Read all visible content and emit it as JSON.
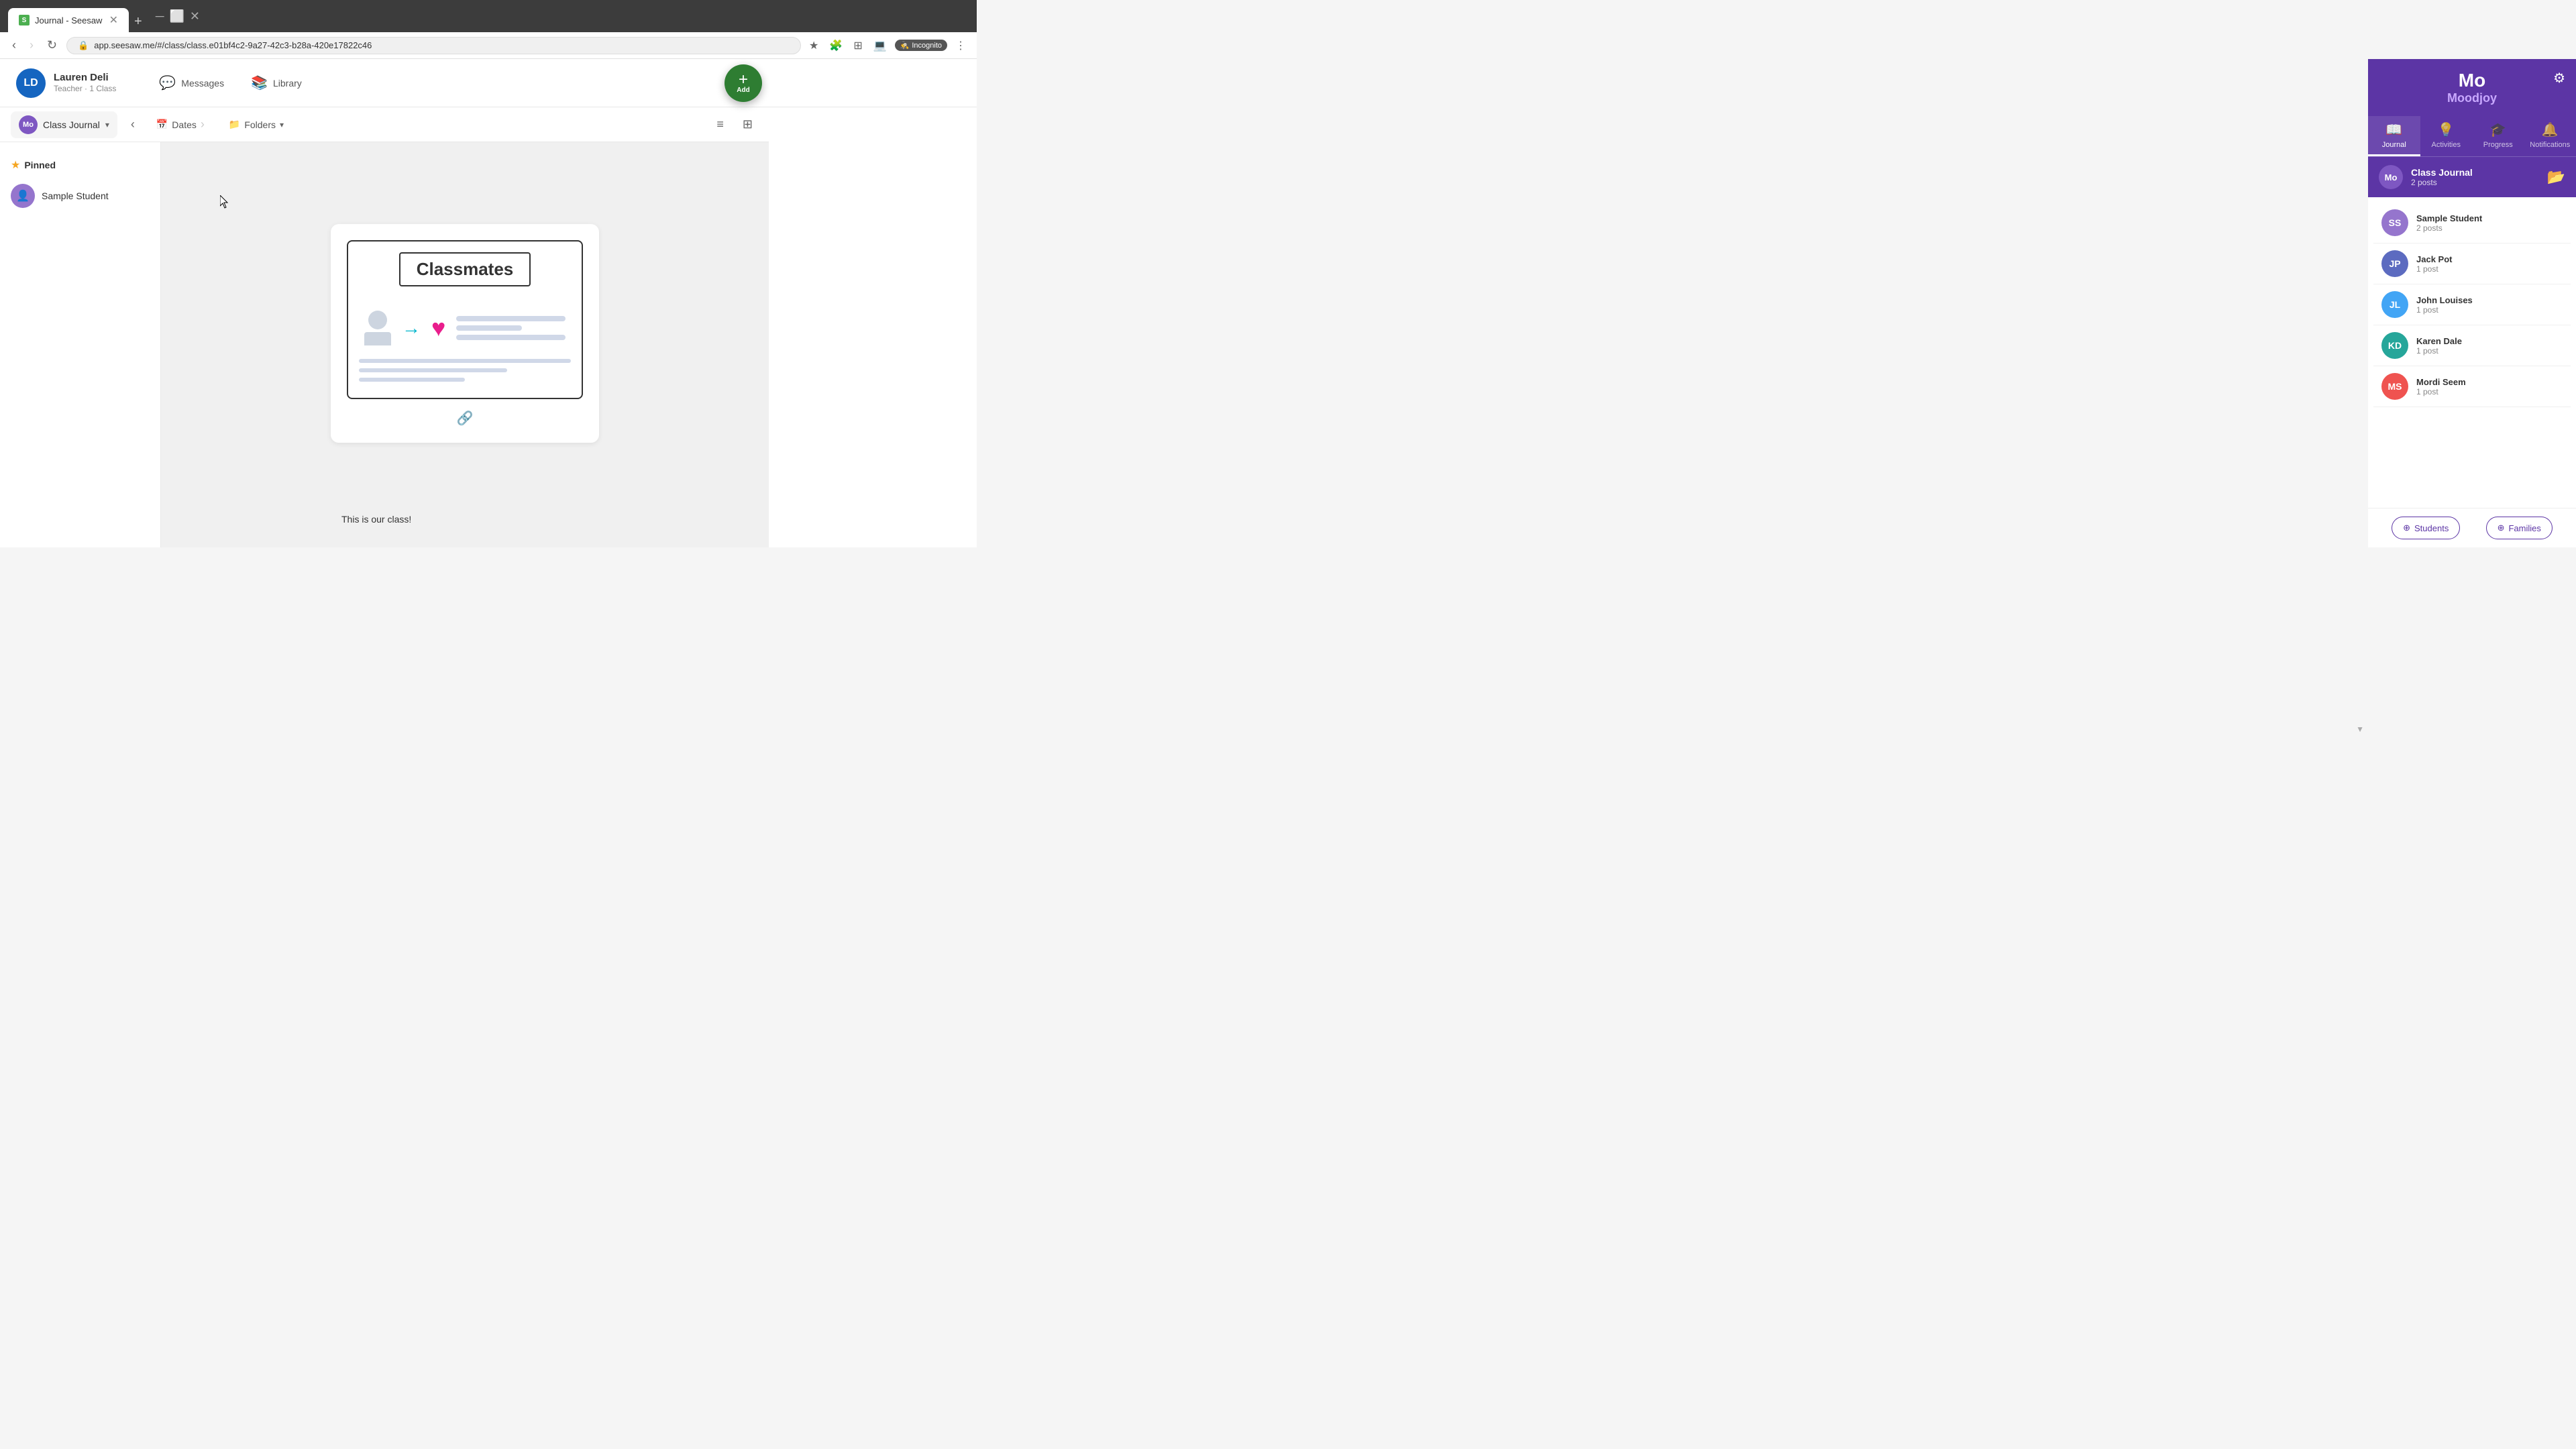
{
  "browser": {
    "tab_title": "Journal - Seesaw",
    "tab_favicon": "S",
    "address": "app.seesaw.me/#/class/class.e01bf4c2-9a27-42c3-b28a-420e17822c46",
    "incognito_label": "Incognito"
  },
  "top_nav": {
    "user_initials": "LD",
    "user_name": "Lauren Deli",
    "user_role": "Teacher · 1 Class",
    "messages_label": "Messages",
    "library_label": "Library",
    "add_label": "Add"
  },
  "toolbar": {
    "class_initials": "Mo",
    "class_name": "Class Journal",
    "dates_label": "Dates",
    "folders_label": "Folders"
  },
  "sidebar": {
    "pinned_label": "Pinned",
    "sample_student_name": "Sample Student"
  },
  "right_panel": {
    "mo_label": "Mo",
    "moodjoy_name": "Moodjoy",
    "tabs": [
      {
        "icon": "📖",
        "label": "Journal",
        "active": true
      },
      {
        "icon": "💡",
        "label": "Activities",
        "active": false
      },
      {
        "icon": "🎓",
        "label": "Progress",
        "active": false
      },
      {
        "icon": "🔔",
        "label": "Notifications",
        "active": false
      }
    ],
    "class_journal": {
      "initials": "Mo",
      "name": "Class Journal",
      "posts": "2 posts"
    },
    "students": [
      {
        "initials": "SS",
        "name": "Sample Student",
        "posts": "2 posts",
        "color": "#9575cd"
      },
      {
        "initials": "JP",
        "name": "Jack Pot",
        "posts": "1 post",
        "color": "#5c6bc0"
      },
      {
        "initials": "JL",
        "name": "John Louises",
        "posts": "1 post",
        "color": "#42a5f5"
      },
      {
        "initials": "KD",
        "name": "Karen Dale",
        "posts": "1 post",
        "color": "#26a69a"
      },
      {
        "initials": "MS",
        "name": "Mordi Seem",
        "posts": "1 post",
        "color": "#ef5350"
      }
    ],
    "bottom": {
      "students_label": "Students",
      "families_label": "Families"
    }
  },
  "feed": {
    "classmates_title": "Classmates",
    "caption": "This is our class!",
    "link_icon": "🔗"
  }
}
